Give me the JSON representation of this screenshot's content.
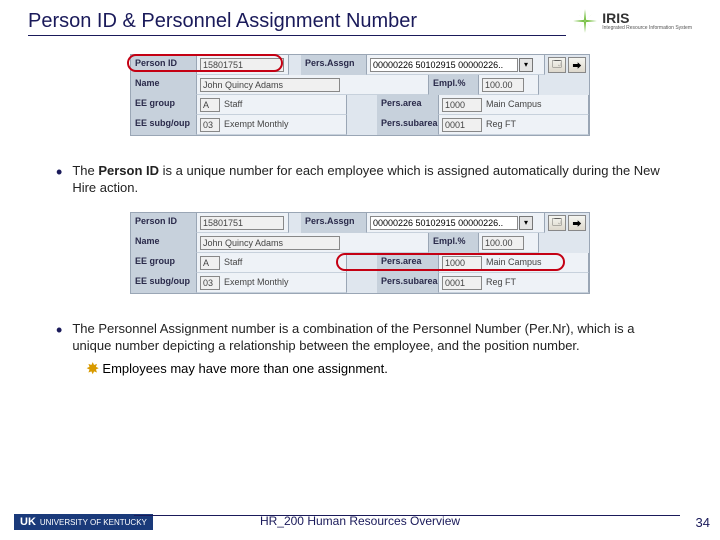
{
  "header": {
    "title": "Person ID & Personnel Assignment Number",
    "logo_text": "IRIS",
    "logo_sub": "Integrated Resource Information System"
  },
  "form": {
    "labels": {
      "person_id": "Person ID",
      "pers_assgn": "Pers.Assgn",
      "name": "Name",
      "empl_pct": "Empl.%",
      "ee_group": "EE group",
      "pers_area": "Pers.area",
      "ee_subgroup": "EE subg/oup",
      "pers_subarea": "Pers.subarea"
    },
    "values": {
      "person_id": "15801751",
      "pers_assgn": "00000226 50102915 00000226..",
      "name": "John Quincy Adams",
      "empl_pct": "100.00",
      "ee_group_code": "A",
      "ee_group_name": "Staff",
      "pers_area_code": "1000",
      "pers_area_name": "Main Campus",
      "ee_sub_code": "03",
      "ee_sub_name": "Exempt Monthly",
      "pers_sub_code": "0001",
      "pers_sub_name": "Reg FT"
    }
  },
  "bullets": {
    "b1_pre": "The ",
    "b1_bold": "Person ID",
    "b1_post": " is a unique number for each employee which is assigned automatically during the New Hire action.",
    "b2": "The Personnel Assignment number is a combination of the Personnel Number (Per.Nr), which is a unique number depicting a relationship between the employee, and the position number.",
    "sub": "Employees may have more than one assignment."
  },
  "footer": {
    "uk_name": "UNIVERSITY OF KENTUCKY",
    "course": "HR_200 Human Resources Overview",
    "page": "34"
  }
}
